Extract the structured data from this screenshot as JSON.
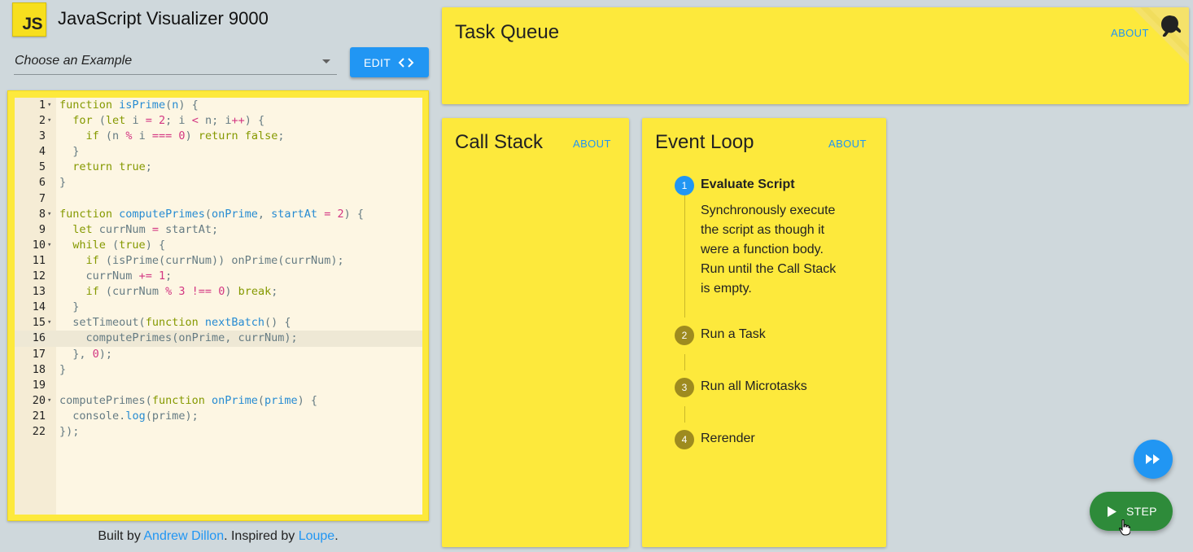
{
  "app": {
    "logo_text": "JS",
    "title": "JavaScript Visualizer 9000"
  },
  "example_select": {
    "value": "Choose an Example"
  },
  "edit_button": {
    "label": "EDIT"
  },
  "editor": {
    "active_line": 16,
    "lines": [
      {
        "n": "1",
        "fold": true
      },
      {
        "n": "2",
        "fold": true
      },
      {
        "n": "3",
        "fold": false
      },
      {
        "n": "4",
        "fold": false
      },
      {
        "n": "5",
        "fold": false
      },
      {
        "n": "6",
        "fold": false
      },
      {
        "n": "7",
        "fold": false
      },
      {
        "n": "8",
        "fold": true
      },
      {
        "n": "9",
        "fold": false
      },
      {
        "n": "10",
        "fold": true
      },
      {
        "n": "11",
        "fold": false
      },
      {
        "n": "12",
        "fold": false
      },
      {
        "n": "13",
        "fold": false
      },
      {
        "n": "14",
        "fold": false
      },
      {
        "n": "15",
        "fold": true
      },
      {
        "n": "16",
        "fold": false
      },
      {
        "n": "17",
        "fold": false
      },
      {
        "n": "18",
        "fold": false
      },
      {
        "n": "19",
        "fold": false
      },
      {
        "n": "20",
        "fold": true
      },
      {
        "n": "21",
        "fold": false
      },
      {
        "n": "22",
        "fold": false
      }
    ],
    "code": [
      "function isPrime(n) {",
      "  for (let i = 2; i < n; i++) {",
      "    if (n % i === 0) return false;",
      "  }",
      "  return true;",
      "}",
      "",
      "function computePrimes(onPrime, startAt = 2) {",
      "  let currNum = startAt;",
      "  while (true) {",
      "    if (isPrime(currNum)) onPrime(currNum);",
      "    currNum += 1;",
      "    if (currNum % 3 !== 0) break;",
      "  }",
      "  setTimeout(function nextBatch() {",
      "    computePrimes(onPrime, currNum);",
      "  }, 0);",
      "}",
      "",
      "computePrimes(function onPrime(prime) {",
      "  console.log(prime);",
      "});"
    ]
  },
  "footer": {
    "built_by": "Built by ",
    "author": "Andrew Dillon",
    "inspired_by": ". Inspired by ",
    "inspiration": "Loupe",
    "end": "."
  },
  "task_queue": {
    "title": "Task Queue",
    "about": "ABOUT"
  },
  "call_stack": {
    "title": "Call Stack",
    "about": "ABOUT"
  },
  "event_loop": {
    "title": "Event Loop",
    "about": "ABOUT",
    "steps": [
      {
        "num": "1",
        "label": "Evaluate Script",
        "active": true
      },
      {
        "num": "2",
        "label": "Run a Task",
        "active": false
      },
      {
        "num": "3",
        "label": "Run all Microtasks",
        "active": false
      },
      {
        "num": "4",
        "label": "Rerender",
        "active": false
      }
    ],
    "active_description_lines": [
      "Synchronously execute",
      "the script as though it",
      "were a function body.",
      "Run until the Call Stack",
      "is empty."
    ]
  },
  "controls": {
    "step_label": "STEP"
  },
  "colors": {
    "panel": "#fde93c",
    "accent_blue": "#2196f3",
    "step_green": "#2e8b3a",
    "background": "#cfd8dc"
  },
  "icons": [
    "code-brackets-icon",
    "fast-forward-icon",
    "play-icon",
    "hand-pointer-icon",
    "github-octocat-icon",
    "dropdown-arrow-icon"
  ]
}
